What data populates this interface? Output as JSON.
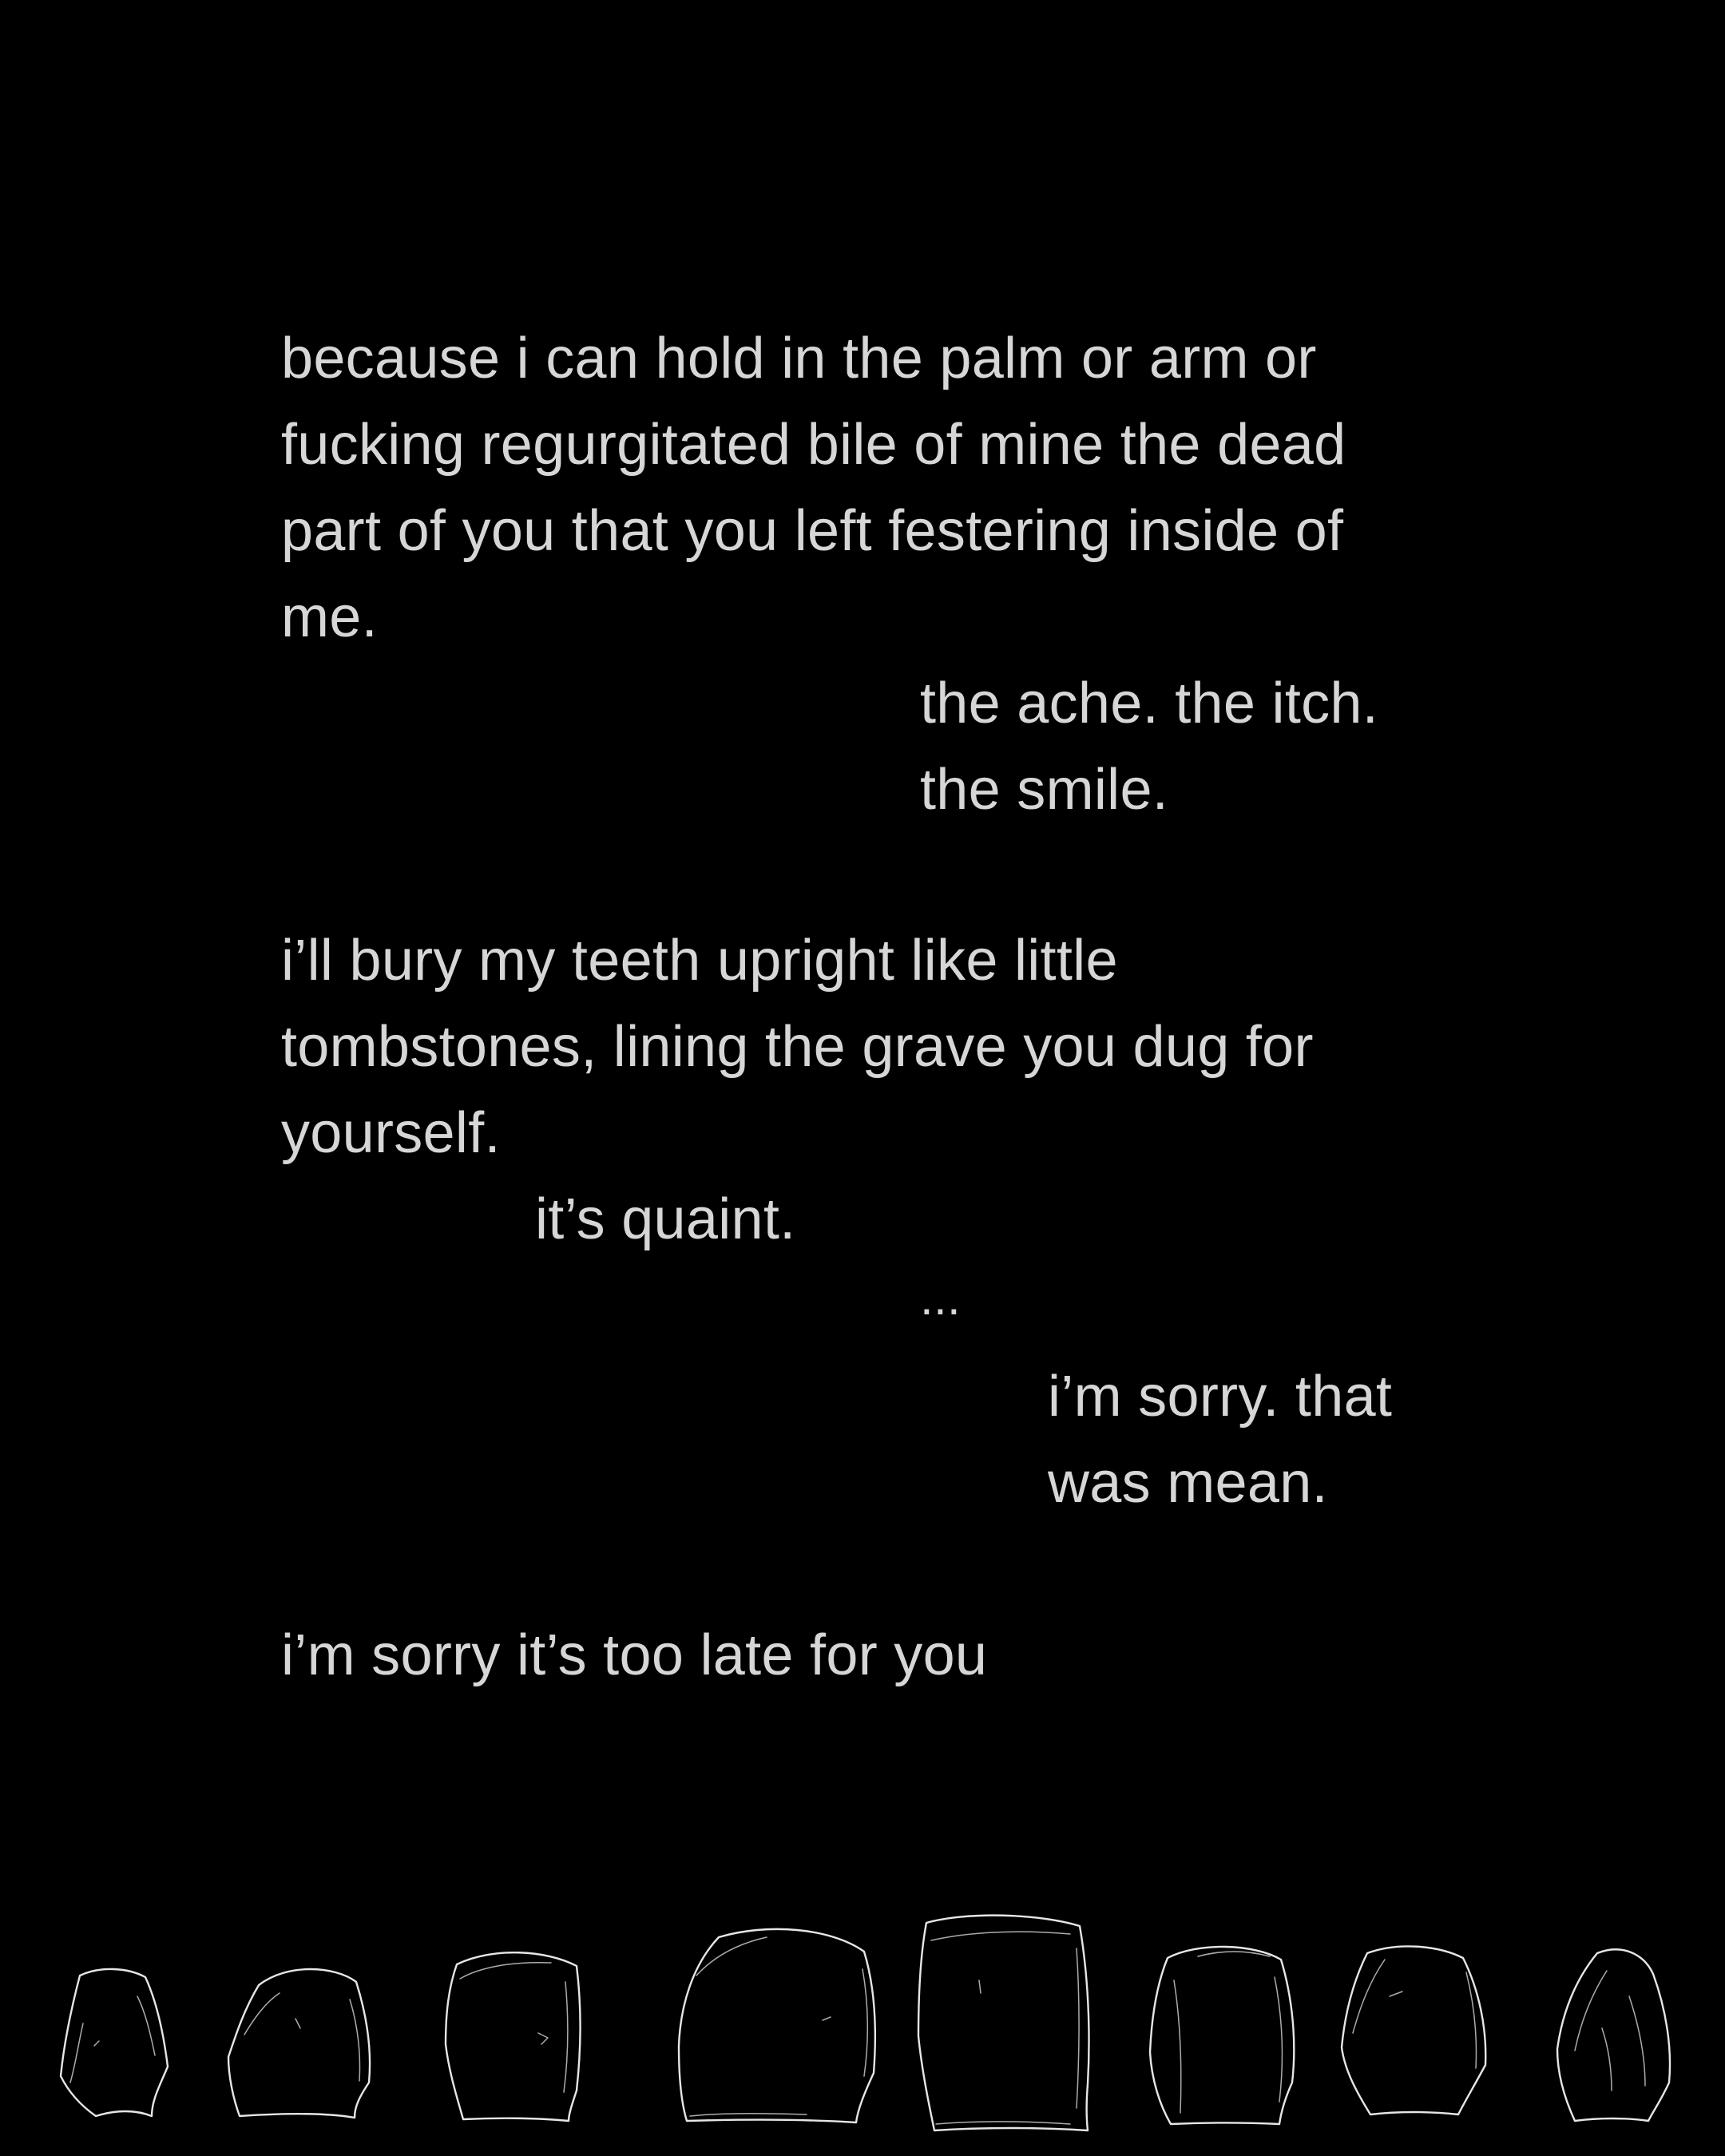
{
  "poem": {
    "stanza1": [
      "because i can hold in the palm or arm or",
      "fucking regurgitated bile of mine the dead",
      "part of you that you left festering inside of",
      "me."
    ],
    "aside1": [
      "the ache. the itch.",
      "the smile."
    ],
    "stanza2": [
      "i’ll bury my teeth upright like little",
      "tombstones, lining the grave you dug for",
      "yourself."
    ],
    "aside2": "it’s quaint.",
    "ellipsis": "...",
    "aside3": [
      "i’m sorry. that",
      "was mean."
    ],
    "closing": "i’m sorry it’s too late for you"
  },
  "drawing": {
    "tooth_icons": [
      "tooth-icon",
      "tooth-icon",
      "tooth-icon",
      "tooth-icon",
      "tooth-icon",
      "tooth-icon",
      "tooth-icon",
      "tooth-icon"
    ]
  },
  "colors": {
    "background": "#000000",
    "text": "#d6d6d6",
    "sketch": "#e6e6e6"
  }
}
